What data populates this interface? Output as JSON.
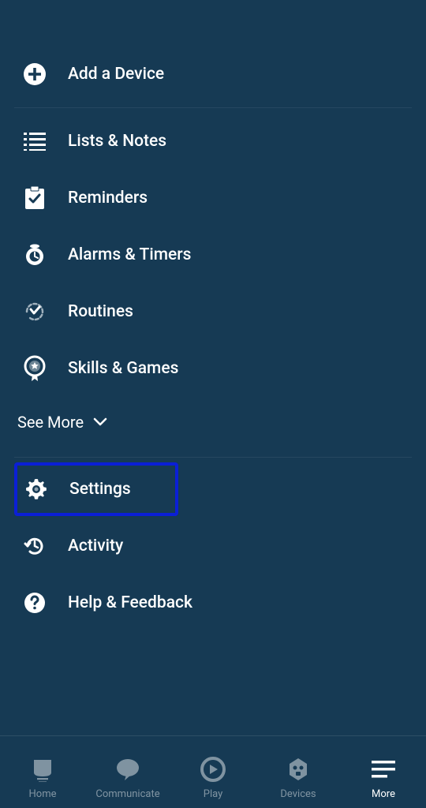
{
  "menu": {
    "add_device": "Add a Device",
    "lists_notes": "Lists & Notes",
    "reminders": "Reminders",
    "alarms_timers": "Alarms & Timers",
    "routines": "Routines",
    "skills_games": "Skills & Games",
    "see_more": "See More",
    "settings": "Settings",
    "activity": "Activity",
    "help_feedback": "Help & Feedback"
  },
  "nav": {
    "home": "Home",
    "communicate": "Communicate",
    "play": "Play",
    "devices": "Devices",
    "more": "More"
  }
}
